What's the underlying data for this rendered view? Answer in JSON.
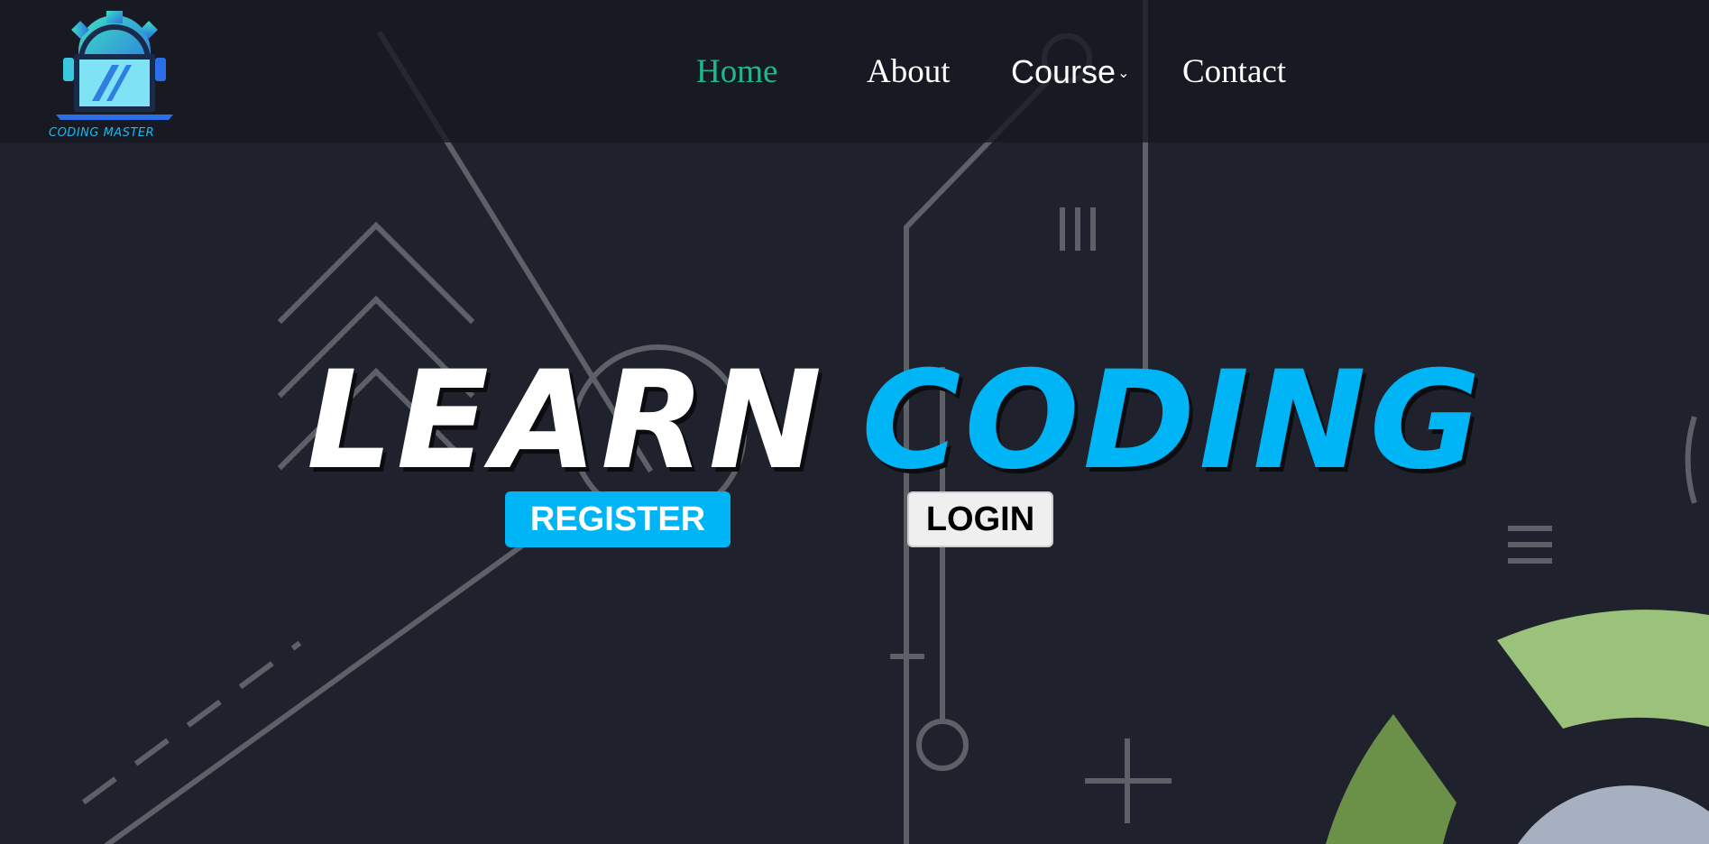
{
  "brand": {
    "name": "CODING MASTER",
    "icon": "laptop-gear-logo-icon"
  },
  "nav": {
    "items": [
      {
        "label": "Home",
        "active": true
      },
      {
        "label": "About",
        "active": false
      },
      {
        "label": "Course",
        "active": false,
        "has_dropdown": true,
        "dropdown_icon": "chevron-down-icon"
      },
      {
        "label": "Contact",
        "active": false
      }
    ]
  },
  "hero": {
    "title_word_1": "LEARN",
    "title_word_2": "CODING"
  },
  "actions": {
    "register_label": "REGISTER",
    "login_label": "LOGIN"
  },
  "colors": {
    "accent_blue": "#00b5f5",
    "active_nav": "#1fb888",
    "background": "#1f222c"
  }
}
